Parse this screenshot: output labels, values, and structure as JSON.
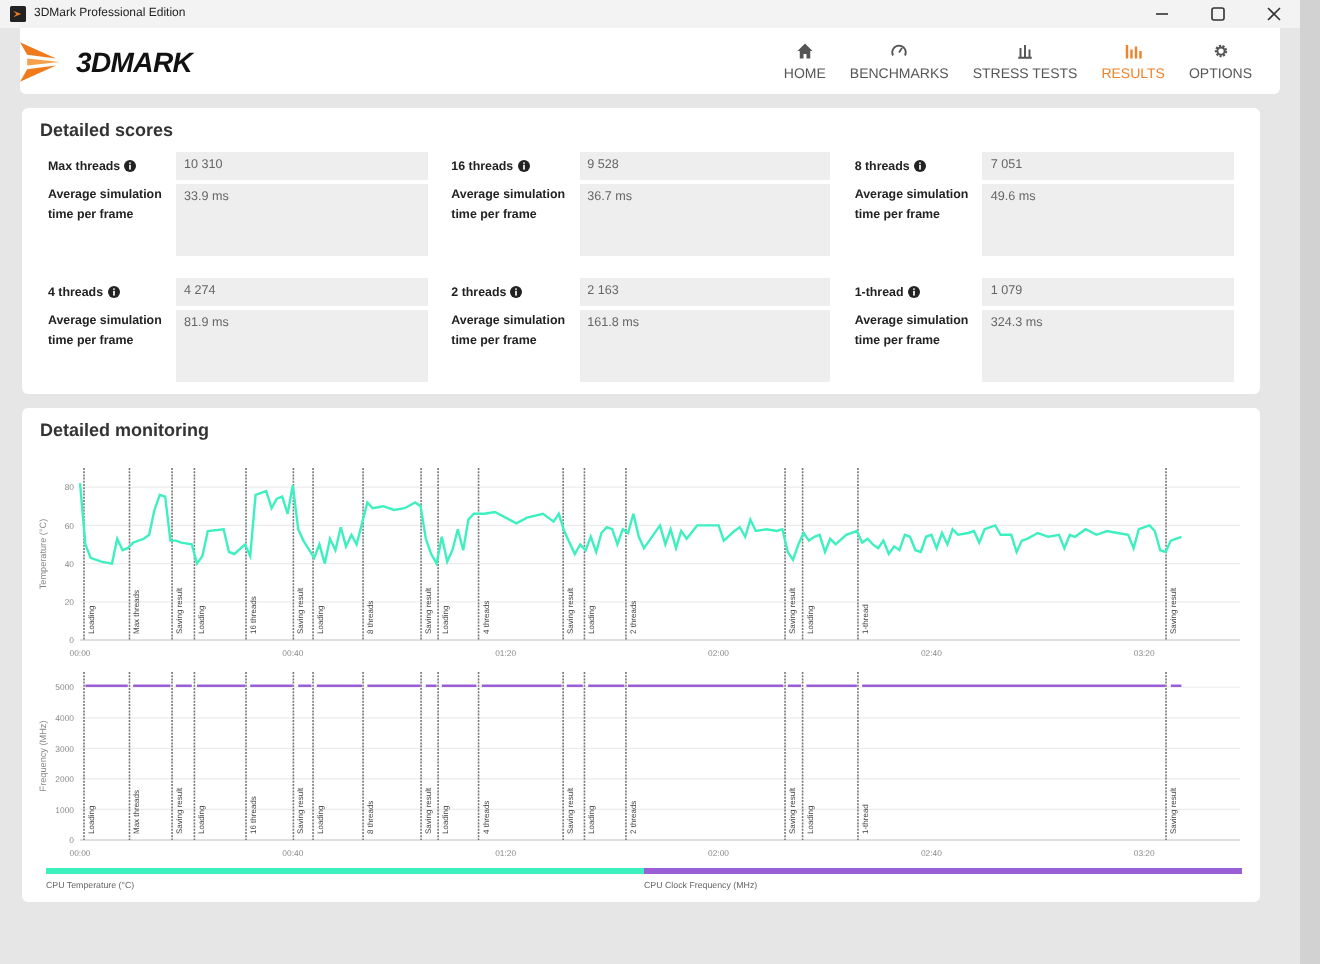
{
  "window": {
    "title": "3DMark Professional Edition"
  },
  "app": {
    "logo": "3DMARK"
  },
  "nav": [
    {
      "label": "HOME",
      "selected": false
    },
    {
      "label": "BENCHMARKS",
      "selected": false
    },
    {
      "label": "STRESS TESTS",
      "selected": false
    },
    {
      "label": "RESULTS",
      "selected": true
    },
    {
      "label": "OPTIONS",
      "selected": false
    }
  ],
  "detailed_scores": {
    "title": "Detailed scores",
    "items": [
      {
        "label": "Max threads",
        "score": "10 310",
        "avg_label": "Average simulation time per frame",
        "avg_value": "33.9 ms"
      },
      {
        "label": "16 threads",
        "score": "9 528",
        "avg_label": "Average simulation time per frame",
        "avg_value": "36.7 ms"
      },
      {
        "label": "8 threads",
        "score": "7 051",
        "avg_label": "Average simulation time per frame",
        "avg_value": "49.6 ms"
      },
      {
        "label": "4 threads",
        "score": "4 274",
        "avg_label": "Average simulation time per frame",
        "avg_value": "81.9 ms"
      },
      {
        "label": "2 threads",
        "score": "2 163",
        "avg_label": "Average simulation time per frame",
        "avg_value": "161.8 ms"
      },
      {
        "label": "1-thread",
        "score": "1 079",
        "avg_label": "Average simulation time per frame",
        "avg_value": "324.3 ms"
      }
    ]
  },
  "detailed_monitoring": {
    "title": "Detailed monitoring",
    "charts": [
      {
        "chart_data": {
          "type": "line",
          "ylabel": "Temperature (°C)",
          "xlim": [
            0,
            218
          ],
          "ylim": [
            0,
            90
          ],
          "grid": true,
          "xticks": [
            {
              "value": 0,
              "label": "00:00"
            },
            {
              "value": 40,
              "label": "00:40"
            },
            {
              "value": 80,
              "label": "01:20"
            },
            {
              "value": 120,
              "label": "02:00"
            },
            {
              "value": 160,
              "label": "02:40"
            },
            {
              "value": 200,
              "label": "03:20"
            }
          ],
          "yticks": [
            0,
            20,
            40,
            60,
            80
          ],
          "x": [
            0,
            1,
            2,
            4,
            6,
            7,
            8,
            9,
            10,
            12,
            13,
            14,
            15,
            16,
            17,
            18,
            19,
            21,
            22,
            23,
            24,
            27,
            28,
            29,
            31,
            32,
            33,
            35,
            36,
            37,
            38,
            39,
            40,
            41,
            42,
            44,
            45,
            46,
            47,
            48,
            49,
            50,
            51,
            52,
            54,
            55,
            57,
            59,
            61,
            63,
            64,
            65,
            66,
            67,
            68,
            69,
            70,
            71,
            72,
            73,
            74,
            76,
            78,
            80,
            82,
            84,
            87,
            89,
            90,
            91,
            93,
            94,
            95,
            96,
            97,
            98,
            99,
            100,
            101,
            102,
            103,
            104,
            105,
            106,
            109,
            110,
            111,
            112,
            113,
            114,
            116,
            118,
            120,
            121,
            123,
            124,
            125,
            126,
            127,
            129,
            131,
            132,
            133,
            134,
            135,
            136,
            137,
            138,
            139,
            140,
            141,
            142,
            144,
            146,
            147,
            148,
            149,
            150,
            151,
            152,
            153,
            154,
            155,
            156,
            157,
            158,
            159,
            160,
            161,
            162,
            163,
            164,
            165,
            167,
            168,
            169,
            170,
            172,
            173,
            175,
            176,
            177,
            178,
            180,
            182,
            184,
            185,
            186,
            187,
            189,
            191,
            193,
            195,
            197,
            198,
            199,
            201,
            202,
            203,
            204,
            205,
            207
          ],
          "series": [
            {
              "name": "CPU Temperature (°C)",
              "color": "#3ef0c0",
              "values": [
                82,
                50,
                43,
                41,
                40,
                53,
                47,
                48,
                51,
                53,
                55,
                68,
                76,
                75,
                52,
                52,
                51,
                50,
                40,
                44,
                57,
                58,
                46,
                45,
                50,
                44,
                76,
                78,
                69,
                74,
                75,
                66,
                81,
                58,
                52,
                43,
                50,
                40,
                53,
                47,
                59,
                49,
                55,
                50,
                72,
                69,
                70,
                68,
                69,
                72,
                70,
                53,
                45,
                40,
                54,
                41,
                47,
                58,
                47,
                63,
                66,
                66,
                67,
                64,
                61,
                64,
                66,
                62,
                66,
                57,
                45,
                50,
                47,
                54,
                46,
                56,
                59,
                58,
                50,
                58,
                56,
                66,
                54,
                48,
                60,
                50,
                58,
                48,
                57,
                53,
                60,
                60,
                60,
                52,
                57,
                59,
                54,
                63,
                57,
                58,
                57,
                58,
                46,
                42,
                50,
                56,
                52,
                54,
                55,
                46,
                53,
                50,
                55,
                57,
                51,
                53,
                50,
                48,
                52,
                45,
                49,
                47,
                55,
                54,
                47,
                46,
                54,
                55,
                48,
                56,
                50,
                58,
                55,
                56,
                57,
                51,
                58,
                60,
                55,
                55,
                46,
                52,
                53,
                56,
                54,
                55,
                48,
                55,
                54,
                58,
                55,
                57,
                56,
                55,
                48,
                58,
                60,
                57,
                47,
                46,
                52,
                54
              ]
            }
          ],
          "ref_lines": [
            {
              "axis": "x",
              "value": 0.75,
              "label": "Loading"
            },
            {
              "axis": "x",
              "value": 9.3,
              "label": "Max threads"
            },
            {
              "axis": "x",
              "value": 17.3,
              "label": "Saving result"
            },
            {
              "axis": "x",
              "value": 21.5,
              "label": "Loading"
            },
            {
              "axis": "x",
              "value": 31.2,
              "label": "16 threads"
            },
            {
              "axis": "x",
              "value": 40.1,
              "label": "Saving result"
            },
            {
              "axis": "x",
              "value": 43.8,
              "label": "Loading"
            },
            {
              "axis": "x",
              "value": 53.2,
              "label": "8 threads"
            },
            {
              "axis": "x",
              "value": 64.1,
              "label": "Saving result"
            },
            {
              "axis": "x",
              "value": 67.3,
              "label": "Loading"
            },
            {
              "axis": "x",
              "value": 74.9,
              "label": "4 threads"
            },
            {
              "axis": "x",
              "value": 90.8,
              "label": "Saving result"
            },
            {
              "axis": "x",
              "value": 94.8,
              "label": "Loading"
            },
            {
              "axis": "x",
              "value": 102.6,
              "label": "2 threads"
            },
            {
              "axis": "x",
              "value": 132.5,
              "label": "Saving result"
            },
            {
              "axis": "x",
              "value": 135.8,
              "label": "Loading"
            },
            {
              "axis": "x",
              "value": 146.2,
              "label": "1-thread"
            },
            {
              "axis": "x",
              "value": 204.1,
              "label": "Saving result"
            }
          ]
        }
      },
      {
        "chart_data": {
          "type": "line",
          "ylabel": "Frequency (MHz)",
          "xlim": [
            0,
            218
          ],
          "ylim": [
            0,
            5500
          ],
          "grid": true,
          "xticks": [
            {
              "value": 0,
              "label": "00:00"
            },
            {
              "value": 40,
              "label": "00:40"
            },
            {
              "value": 80,
              "label": "01:20"
            },
            {
              "value": 120,
              "label": "02:00"
            },
            {
              "value": 160,
              "label": "02:40"
            },
            {
              "value": 200,
              "label": "03:20"
            }
          ],
          "yticks": [
            0,
            1000,
            2000,
            3000,
            4000,
            5000
          ],
          "x": [
            1,
            9,
            9.3,
            10,
            17,
            17.3,
            18,
            21,
            21.5,
            22,
            31,
            31.2,
            32,
            40,
            40.1,
            41,
            43.5,
            43.8,
            44.5,
            53,
            53.2,
            54,
            64,
            64.1,
            65,
            67,
            67.3,
            68,
            74.5,
            74.9,
            75.5,
            90.5,
            90.8,
            91.5,
            94.5,
            94.8,
            95.5,
            102.3,
            102.6,
            103,
            132.2,
            132.5,
            133,
            135.5,
            135.8,
            136.5,
            146,
            146.2,
            147,
            204,
            204.1,
            205,
            207
          ],
          "series": [
            {
              "name": "CPU Clock Frequency (MHz)",
              "color": "#9a5fd6",
              "values": [
                5050,
                5050,
                null,
                5050,
                5050,
                null,
                5050,
                5050,
                null,
                5050,
                5050,
                null,
                5050,
                5050,
                null,
                5050,
                5050,
                null,
                5050,
                5050,
                null,
                5050,
                5050,
                null,
                5050,
                5050,
                null,
                5050,
                5050,
                null,
                5050,
                5050,
                null,
                5050,
                5050,
                null,
                5050,
                5050,
                null,
                5050,
                5050,
                null,
                5050,
                5050,
                null,
                5050,
                5050,
                null,
                5050,
                5050,
                null,
                5050,
                5050
              ]
            }
          ],
          "ref_lines": [
            {
              "axis": "x",
              "value": 0.75,
              "label": "Loading"
            },
            {
              "axis": "x",
              "value": 9.3,
              "label": "Max threads"
            },
            {
              "axis": "x",
              "value": 17.3,
              "label": "Saving result"
            },
            {
              "axis": "x",
              "value": 21.5,
              "label": "Loading"
            },
            {
              "axis": "x",
              "value": 31.2,
              "label": "16 threads"
            },
            {
              "axis": "x",
              "value": 40.1,
              "label": "Saving result"
            },
            {
              "axis": "x",
              "value": 43.8,
              "label": "Loading"
            },
            {
              "axis": "x",
              "value": 53.2,
              "label": "8 threads"
            },
            {
              "axis": "x",
              "value": 64.1,
              "label": "Saving result"
            },
            {
              "axis": "x",
              "value": 67.3,
              "label": "Loading"
            },
            {
              "axis": "x",
              "value": 74.9,
              "label": "4 threads"
            },
            {
              "axis": "x",
              "value": 90.8,
              "label": "Saving result"
            },
            {
              "axis": "x",
              "value": 94.8,
              "label": "Loading"
            },
            {
              "axis": "x",
              "value": 102.6,
              "label": "2 threads"
            },
            {
              "axis": "x",
              "value": 132.5,
              "label": "Saving result"
            },
            {
              "axis": "x",
              "value": 135.8,
              "label": "Loading"
            },
            {
              "axis": "x",
              "value": 146.2,
              "label": "1-thread"
            },
            {
              "axis": "x",
              "value": 204.1,
              "label": "Saving result"
            }
          ]
        }
      }
    ]
  }
}
